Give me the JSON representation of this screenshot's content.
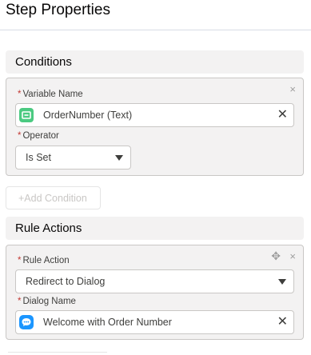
{
  "panel": {
    "title": "Step Properties"
  },
  "conditions": {
    "header": "Conditions",
    "variable_label": "Variable Name",
    "variable_value": "OrderNumber (Text)",
    "operator_label": "Operator",
    "operator_value": "Is Set",
    "add_button": "+Add Condition",
    "close_icon": "×",
    "variable_icon_color": "#4bca81"
  },
  "rule_actions": {
    "header": "Rule Actions",
    "action_label": "Rule Action",
    "action_value": "Redirect to Dialog",
    "dialog_label": "Dialog Name",
    "dialog_value": "Welcome with Order Number",
    "move_icon": "✥",
    "close_icon": "×",
    "dialog_icon_color": "#1b96ff"
  },
  "common": {
    "required_marker": "*",
    "clear_icon": "✕"
  }
}
